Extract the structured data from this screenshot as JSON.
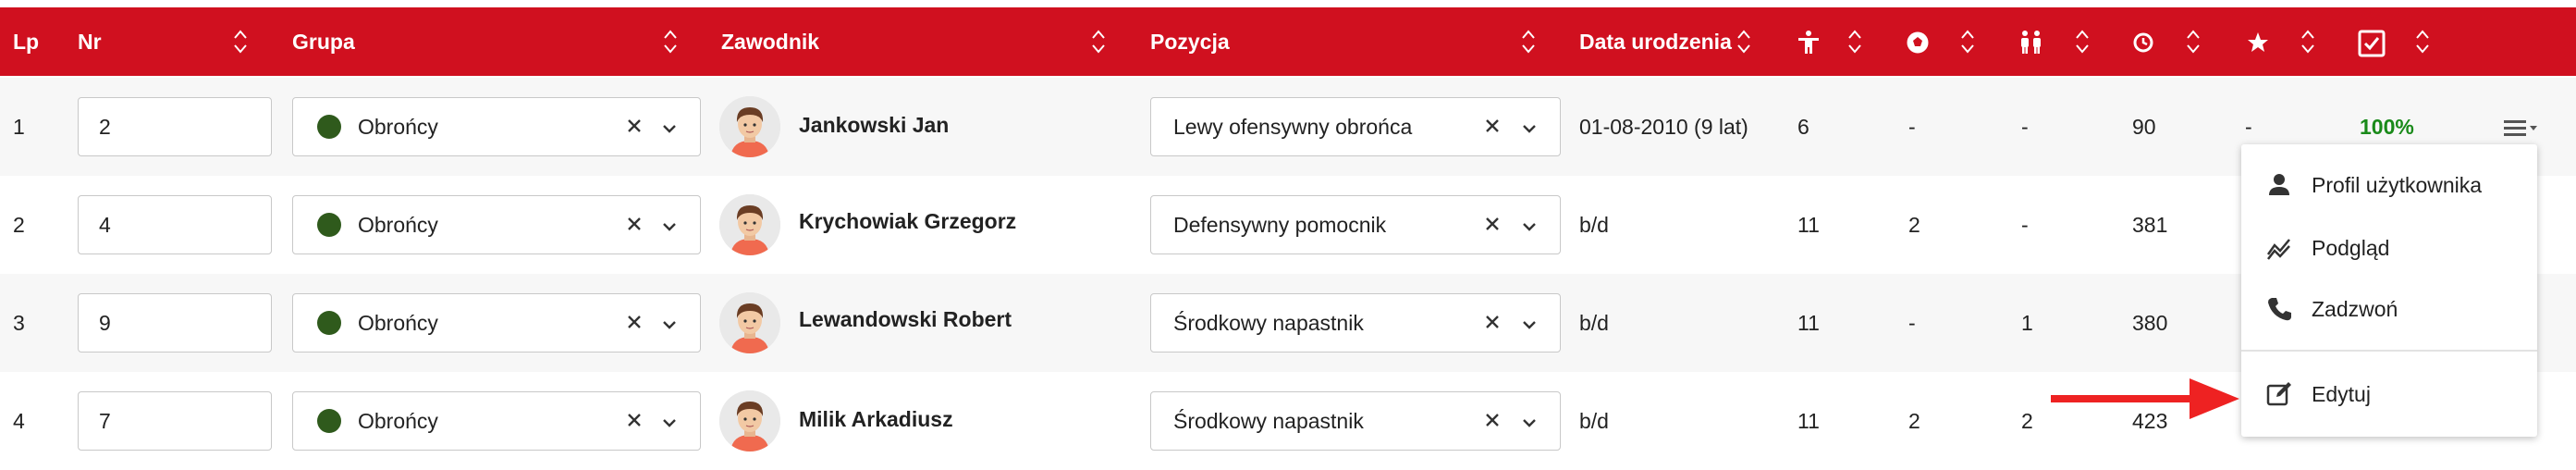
{
  "header": {
    "lp": "Lp",
    "nr": "Nr",
    "grupa": "Grupa",
    "zawodnik": "Zawodnik",
    "pozycja": "Pozycja",
    "data_urodzenia": "Data urodzenia",
    "stat_icons": [
      "appearances-icon",
      "goals-ball-icon",
      "substitutions-icon",
      "minutes-clock-icon",
      "rating-star-icon",
      "attendance-check-icon"
    ]
  },
  "colors": {
    "header_bg": "#d0101f",
    "group_dot": "#2f5a1c",
    "percent_text": "#1a8a1a",
    "arrow": "#ee2222"
  },
  "rows": [
    {
      "lp": "1",
      "nr": "2",
      "grupa": "Obrońcy",
      "zawodnik": "Jankowski Jan",
      "pozycja": "Lewy ofensywny obrońca",
      "data_urodzenia": "01-08-2010 (9 lat)",
      "s1": "6",
      "s2": "-",
      "s3": "-",
      "s4": "90",
      "s5": "-",
      "s6": "100%"
    },
    {
      "lp": "2",
      "nr": "4",
      "grupa": "Obrońcy",
      "zawodnik": "Krychowiak Grzegorz",
      "pozycja": "Defensywny pomocnik",
      "data_urodzenia": "b/d",
      "s1": "11",
      "s2": "2",
      "s3": "-",
      "s4": "381"
    },
    {
      "lp": "3",
      "nr": "9",
      "grupa": "Obrońcy",
      "zawodnik": "Lewandowski Robert",
      "pozycja": "Środkowy napastnik",
      "data_urodzenia": "b/d",
      "s1": "11",
      "s2": "-",
      "s3": "1",
      "s4": "380"
    },
    {
      "lp": "4",
      "nr": "7",
      "grupa": "Obrońcy",
      "zawodnik": "Milik Arkadiusz",
      "pozycja": "Środkowy napastnik",
      "data_urodzenia": "b/d",
      "s1": "11",
      "s2": "2",
      "s3": "2",
      "s4": "423"
    }
  ],
  "dropdown": {
    "items": [
      {
        "label": "Profil użytkownika",
        "icon": "person-icon"
      },
      {
        "label": "Podgląd",
        "icon": "trend-line-icon"
      },
      {
        "label": "Zadzwoń",
        "icon": "phone-icon"
      },
      {
        "label": "Edytuj",
        "icon": "edit-icon"
      }
    ]
  }
}
